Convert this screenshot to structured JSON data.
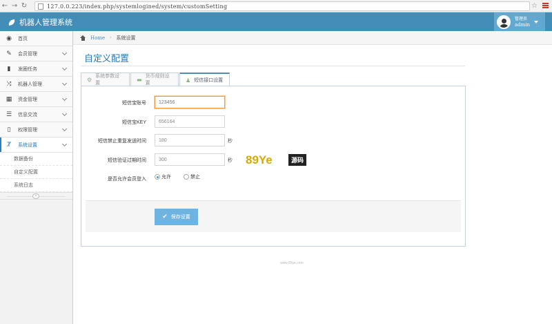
{
  "browser": {
    "url": "127.0.0.223/index.php/systemlogined/system/customSetting"
  },
  "app": {
    "title": "机器人管理系统",
    "user": {
      "role": "管理员",
      "name": "admin"
    }
  },
  "sidebar": {
    "items": [
      {
        "label": "首页",
        "icon": "dashboard-icon"
      },
      {
        "label": "会员管理",
        "icon": "edit-icon"
      },
      {
        "label": "发圈任务",
        "icon": "book-icon"
      },
      {
        "label": "机器人管理",
        "icon": "shuffle-icon"
      },
      {
        "label": "资金管理",
        "icon": "calendar-icon"
      },
      {
        "label": "信息交流",
        "icon": "list-icon"
      },
      {
        "label": "权限管理",
        "icon": "file-icon"
      },
      {
        "label": "系统设置",
        "icon": "text-width-icon"
      }
    ],
    "sub_items": [
      {
        "label": "数据备份"
      },
      {
        "label": "自定义配置"
      },
      {
        "label": "系统日志"
      }
    ]
  },
  "breadcrumb": {
    "home": "Home",
    "current": "系统设置"
  },
  "page": {
    "title": "自定义配置"
  },
  "tabs": [
    {
      "label": "系统参数设置",
      "icon": "cogs-icon"
    },
    {
      "label": "货币规则设置",
      "icon": "credit-card-icon"
    },
    {
      "label": "短信接口设置",
      "icon": "user-icon"
    }
  ],
  "form": {
    "sms_account": {
      "label": "短信宝账号",
      "value": "123456"
    },
    "sms_key": {
      "label": "短信宝KEY",
      "value": "656164"
    },
    "sms_resend_ban": {
      "label": "短信禁止重复发送时间",
      "value": "180",
      "unit": "秒"
    },
    "sms_code_expire": {
      "label": "短信验证过期时间",
      "value": "300",
      "unit": "秒"
    },
    "allow_member_login": {
      "label": "是否允许会员登入",
      "options": [
        "允许",
        "禁止"
      ],
      "selected": "允许"
    },
    "save_label": "保存设置"
  },
  "watermark": {
    "main": "89Ye",
    "box": "源码",
    "sub": "www.89ye.com"
  }
}
